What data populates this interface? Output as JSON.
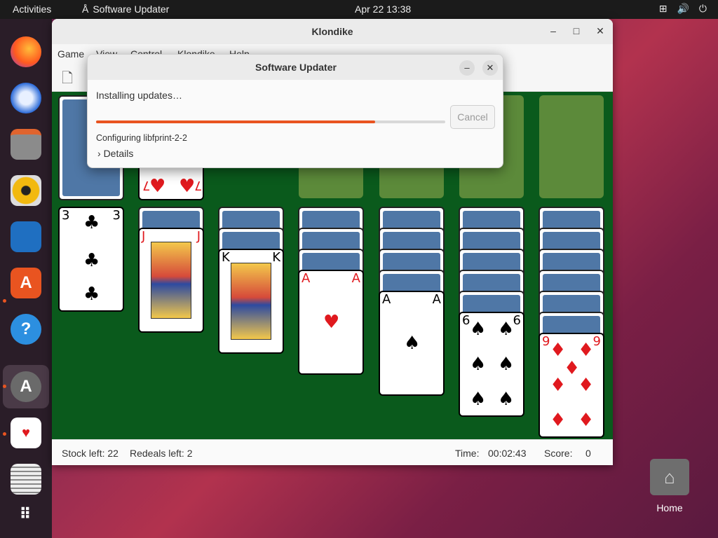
{
  "topbar": {
    "activities": "Activities",
    "app_name": "Software Updater",
    "clock": "Apr 22  13:38"
  },
  "dock": {
    "items": [
      "firefox-icon",
      "thunderbird-icon",
      "files-icon",
      "rhythmbox-icon",
      "writer-icon",
      "app-center-icon",
      "help-icon",
      "software-updater-icon",
      "solitaire-icon",
      "text-editor-icon",
      "show-apps-icon"
    ]
  },
  "desktop": {
    "home_label": "Home"
  },
  "klondike": {
    "title": "Klondike",
    "menu": [
      "Game",
      "View",
      "Control",
      "Klondike",
      "Help"
    ],
    "status": {
      "stock_label": "Stock left: 22",
      "redeals_label": "Redeals left: 2",
      "time_label": "Time:",
      "time_value": "00:02:43",
      "score_label": "Score:",
      "score_value": "0"
    },
    "waste_card": {
      "rank": "7",
      "suit": "♥"
    },
    "tableau": [
      {
        "rank": "3",
        "suit": "♣",
        "color": "black"
      },
      {
        "rank": "J",
        "suit": "♦",
        "color": "red"
      },
      {
        "rank": "K",
        "suit": "♣",
        "color": "black"
      },
      {
        "rank": "A",
        "suit": "♥",
        "color": "red"
      },
      {
        "rank": "A",
        "suit": "♠",
        "color": "black"
      },
      {
        "rank": "6",
        "suit": "♠",
        "color": "black"
      },
      {
        "rank": "9",
        "suit": "♦",
        "color": "red"
      }
    ]
  },
  "updater": {
    "title": "Software Updater",
    "status": "Installing updates…",
    "progress": 0.8,
    "cancel_label": "Cancel",
    "current_job": "Configuring libfprint-2-2",
    "details_label": "Details"
  },
  "colors": {
    "accent": "#e95420",
    "felt": "#0a5a1c",
    "card_back": "#4f77a6"
  }
}
